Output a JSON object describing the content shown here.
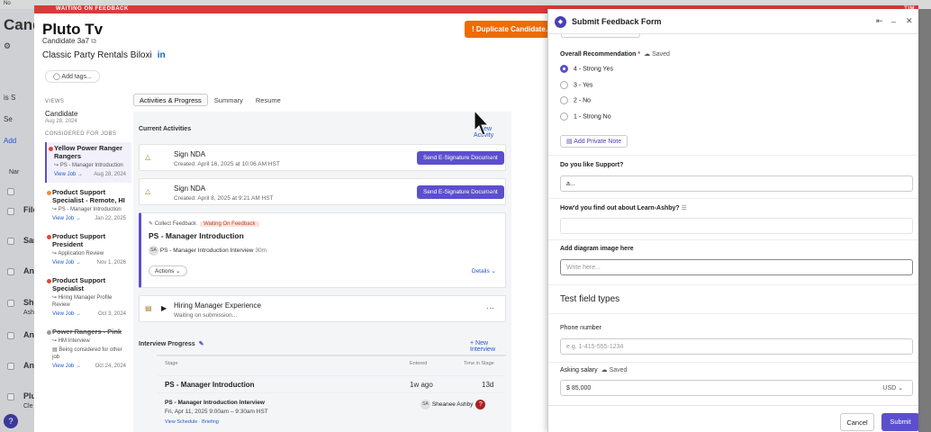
{
  "topstrip": {
    "text": "No"
  },
  "bgapp": {
    "title": "Candi",
    "rows": [
      "File",
      "Sar",
      "An",
      "She",
      "An",
      "An",
      "Plu"
    ],
    "misc": [
      "Se",
      "Add",
      "Nar",
      "Cle",
      "Ash",
      "is S"
    ]
  },
  "banner": {
    "text": "WAITING ON FEEDBACK",
    "right": "TIM"
  },
  "candidate": {
    "name": "Pluto Tv",
    "sub": "Candidate 3a7",
    "company": "Classic Party Rentals Biloxi",
    "linkedin": "in",
    "add_tags": "Add tags..."
  },
  "duplicate_button": "! Duplicate Candidate...",
  "views": {
    "title": "VIEWS",
    "candidate_label": "Candidate",
    "candidate_date": "Aug 28, 2024",
    "considered_title": "CONSIDERED FOR JOBS",
    "jobs": [
      {
        "title": "Yellow Power Ranger Rangers",
        "stage": "PS - Manager Introduction",
        "view": "View Job →",
        "date": "Aug 28, 2024",
        "color": "#e0453a"
      },
      {
        "title": "Product Support Specialist - Remote, HI",
        "stage": "PS - Manager Introduction",
        "view": "View Job →",
        "date": "Jan 22, 2025",
        "color": "#f08a3a"
      },
      {
        "title": "Product Support President",
        "stage": "Application Review",
        "view": "View Job →",
        "date": "Nov 1, 2026",
        "color": "#e0453a"
      },
      {
        "title": "Product Support Specialist",
        "stage": "Hiring Manager Profile Review",
        "view": "View Job →",
        "date": "Oct 3, 2024",
        "color": "#e0453a"
      },
      {
        "title": "Power Rangers - Pink",
        "stage": "HM Interview",
        "stage2": "Being considered for other job",
        "view": "View Job →",
        "date": "Oct 24, 2024",
        "color": "#999"
      }
    ]
  },
  "tabs": [
    "Activities & Progress",
    "Summary",
    "Resume"
  ],
  "activities": {
    "title": "Current Activities",
    "new_activity": "+ New Activity",
    "items": [
      {
        "title": "Sign NDA",
        "sub": "Created: April 16, 2025 at 10:06 AM HST",
        "button": "Send E-Signature Document"
      },
      {
        "title": "Sign NDA",
        "sub": "Created: April 8, 2025 at 9:21 AM HST",
        "button": "Send E-Signature Document"
      }
    ],
    "collect": {
      "label": "Collect Feedback",
      "badge": "Waiting On Feedback",
      "title": "PS - Manager Introduction",
      "avatar": "SA",
      "interview": "PS - Manager Introduction Interview",
      "duration": "30m",
      "actions": "Actions ⌄",
      "details": "Details ⌄"
    },
    "hiring": {
      "title": "Hiring Manager Experience",
      "sub": "Waiting on submission..."
    }
  },
  "interview_progress": {
    "title": "Interview Progress",
    "new_interview": "+ New Interview",
    "cols": [
      "Stage",
      "Entered",
      "Time in Stage"
    ],
    "stage": "PS - Manager Introduction",
    "entered": "1w ago",
    "time": "13d",
    "interview_title": "PS - Manager Introduction Interview",
    "interview_date": "Fri, Apr 11, 2025 9:00am – 9:30am HST",
    "person_avatar": "SA",
    "person": "Sheanee Ashby",
    "links": "View Schedule · Briefing"
  },
  "feedback_form": {
    "title": "Submit Feedback Form",
    "controls": [
      "⇤",
      "_",
      "✕"
    ],
    "overall": {
      "label": "Overall Recommendation",
      "required": "*",
      "saved": "Saved"
    },
    "options": [
      "4 - Strong Yes",
      "3 - Yes",
      "2 - No",
      "1 - Strong No"
    ],
    "selected": 0,
    "private_note": "Add Private Note",
    "q1": {
      "label": "Do you like Support?",
      "value": "a..."
    },
    "q2": {
      "label": "How'd you find out about Learn-Ashby?"
    },
    "q3": {
      "label": "Add diagram image here",
      "placeholder": "Write here..."
    },
    "section": "Test field types",
    "phone": {
      "label": "Phone number",
      "placeholder": "e.g. 1-415-555-1234"
    },
    "salary": {
      "label": "Asking salary",
      "saved": "Saved",
      "value": "$  85,000",
      "currency": "USD ⌄"
    },
    "cancel": "Cancel",
    "submit": "Submit"
  },
  "help": "?"
}
